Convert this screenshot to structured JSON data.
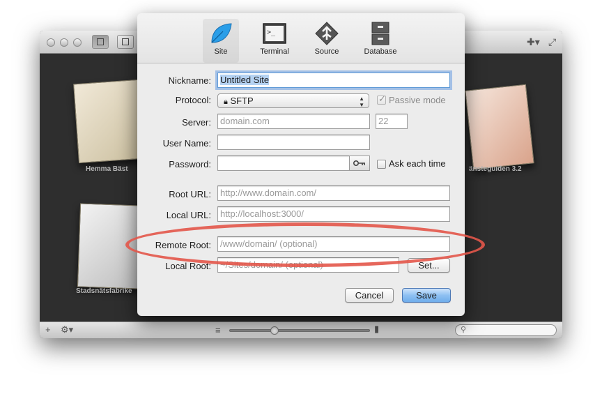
{
  "background_window": {
    "sites": [
      {
        "label": "Hemma Bäst"
      },
      {
        "label": "änsteguiden 3.2"
      },
      {
        "label": "Stadsnätsfabrike"
      }
    ]
  },
  "dialog": {
    "toolbar": [
      {
        "label": "Site",
        "icon": "leaf-icon"
      },
      {
        "label": "Terminal",
        "icon": "terminal-icon"
      },
      {
        "label": "Source",
        "icon": "source-icon"
      },
      {
        "label": "Database",
        "icon": "database-icon"
      }
    ],
    "form": {
      "nickname_label": "Nickname:",
      "nickname_value": "Untitled Site",
      "protocol_label": "Protocol:",
      "protocol_value": "SFTP",
      "passive_mode_label": "Passive mode",
      "passive_mode_checked": true,
      "server_label": "Server:",
      "server_placeholder": "domain.com",
      "port_placeholder": "22",
      "username_label": "User Name:",
      "password_label": "Password:",
      "ask_each_time_label": "Ask each time",
      "root_url_label": "Root URL:",
      "root_url_placeholder": "http://www.domain.com/",
      "local_url_label": "Local URL:",
      "local_url_placeholder": "http://localhost:3000/",
      "remote_root_label": "Remote Root:",
      "remote_root_placeholder": "/www/domain/ (optional)",
      "local_root_label": "Local Root:",
      "local_root_placeholder": "~/Sites/domain/ (optional)",
      "set_button": "Set..."
    },
    "buttons": {
      "cancel": "Cancel",
      "save": "Save"
    }
  },
  "colors": {
    "highlight_ellipse": "#e3574a",
    "default_button": "#6fadeb",
    "focus_ring": "#5f9ad7"
  }
}
